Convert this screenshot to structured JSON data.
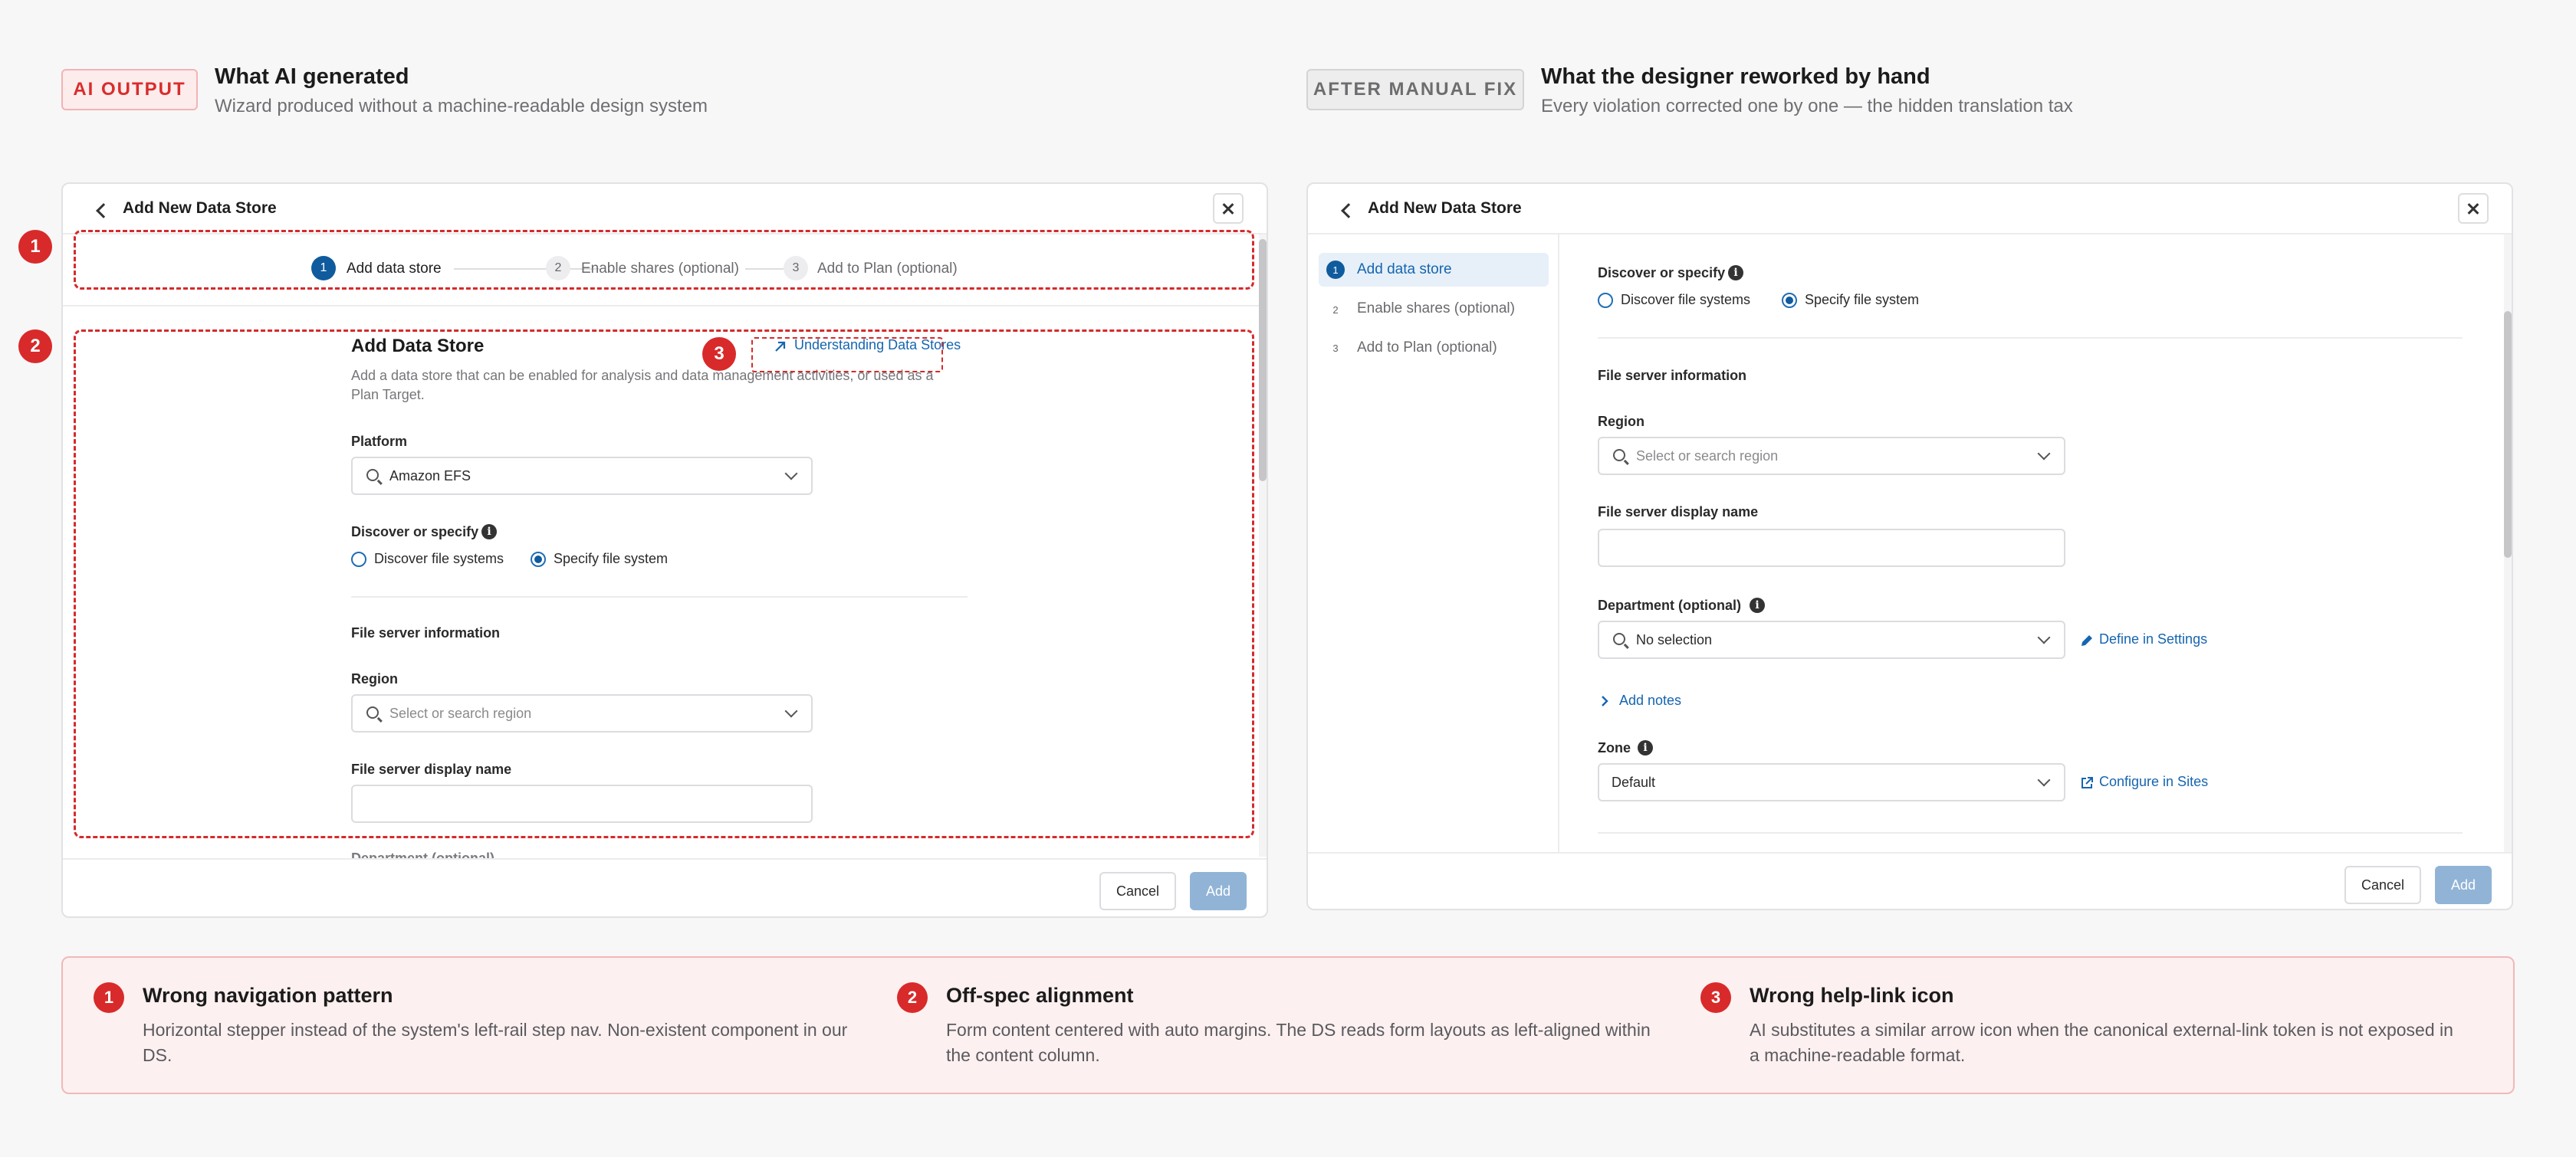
{
  "left_header": {
    "tag": "AI OUTPUT",
    "title": "What AI generated",
    "subtitle": "Wizard produced without a machine-readable design system"
  },
  "right_header": {
    "tag": "AFTER MANUAL FIX",
    "title": "What the designer reworked by hand",
    "subtitle": "Every violation corrected one by one — the hidden translation tax"
  },
  "ai_panel": {
    "title": "Add New Data Store",
    "steps": [
      {
        "num": "1",
        "label": "Add data store"
      },
      {
        "num": "2",
        "label": "Enable shares (optional)"
      },
      {
        "num": "3",
        "label": "Add to Plan (optional)"
      }
    ],
    "form_heading": "Add Data Store",
    "help_link": "Understanding Data Stores",
    "description_line1": "Add a data store that can be enabled for analysis and data management activities, or used as a",
    "description_line2": "Plan Target.",
    "platform_label": "Platform",
    "platform_value": "Amazon EFS",
    "discover_label": "Discover or specify",
    "radio_discover": "Discover file systems",
    "radio_specify": "Specify file system",
    "section_title": "File server information",
    "region_label": "Region",
    "region_placeholder": "Select or search region",
    "display_name_label": "File server display name",
    "cut_label": "Department (optional)",
    "cancel": "Cancel",
    "add": "Add"
  },
  "fixed_panel": {
    "title": "Add New Data Store",
    "nav": [
      {
        "num": "1",
        "label": "Add data store"
      },
      {
        "num": "2",
        "label": "Enable shares (optional)"
      },
      {
        "num": "3",
        "label": "Add to Plan (optional)"
      }
    ],
    "discover_label": "Discover or specify",
    "radio_discover": "Discover file systems",
    "radio_specify": "Specify file system",
    "section_title": "File server information",
    "region_label": "Region",
    "region_placeholder": "Select or search region",
    "display_name_label": "File server display name",
    "department_label": "Department (optional)",
    "department_value": "No selection",
    "define_link": "Define in Settings",
    "add_notes": "Add notes",
    "zone_label": "Zone",
    "zone_value": "Default",
    "configure_link": "Configure in Sites",
    "cancel": "Cancel",
    "add": "Add"
  },
  "callouts": [
    {
      "num": "1",
      "title": "Wrong navigation pattern",
      "text": "Horizontal stepper instead of the system's left-rail step nav. Non-existent component in our DS."
    },
    {
      "num": "2",
      "title": "Off-spec alignment",
      "text": "Form content centered with auto margins. The DS reads form layouts as left-aligned within the content column."
    },
    {
      "num": "3",
      "title": "Wrong help-link icon",
      "text": "AI substitutes a similar arrow icon when the canonical external-link token is not exposed in a machine-readable format."
    }
  ],
  "colors": {
    "accent": "#0f5b9e",
    "link": "#1565b0",
    "violation": "#d52a2a",
    "add_button_disabled": "#91b4d6"
  }
}
